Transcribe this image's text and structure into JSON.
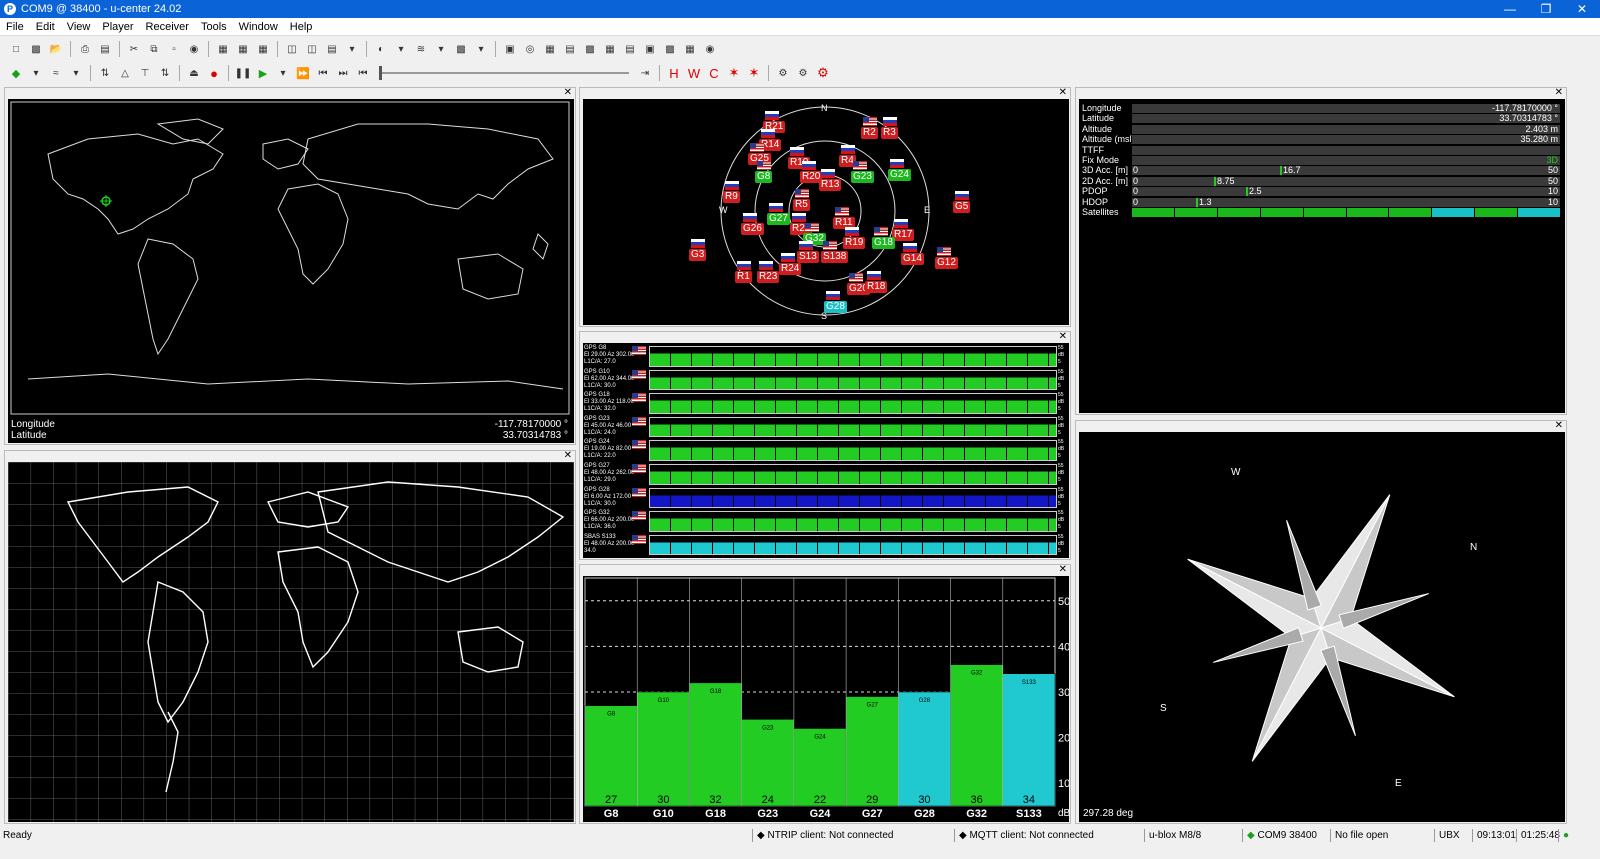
{
  "window": {
    "title": "COM9 @ 38400 - u-center 24.02",
    "icon": "P"
  },
  "menu": [
    "File",
    "Edit",
    "View",
    "Player",
    "Receiver",
    "Tools",
    "Window",
    "Help"
  ],
  "map1": {
    "lon_label": "Longitude",
    "lon_value": "-117.78170000 °",
    "lat_label": "Latitude",
    "lat_value": "33.70314783 °"
  },
  "sky": {
    "compass": [
      "N",
      "E",
      "S",
      "W"
    ],
    "sats": [
      {
        "id": "R21",
        "t": "r"
      },
      {
        "id": "R2",
        "t": "r"
      },
      {
        "id": "R3",
        "t": "r"
      },
      {
        "id": "R14",
        "t": "r"
      },
      {
        "id": "G25",
        "t": "r"
      },
      {
        "id": "R10",
        "t": "r"
      },
      {
        "id": "R4",
        "t": "r"
      },
      {
        "id": "G8",
        "t": "g"
      },
      {
        "id": "R20",
        "t": "r"
      },
      {
        "id": "R13",
        "t": "r"
      },
      {
        "id": "G23",
        "t": "g"
      },
      {
        "id": "G24",
        "t": "g"
      },
      {
        "id": "R9",
        "t": "r"
      },
      {
        "id": "R5",
        "t": "r"
      },
      {
        "id": "G5",
        "t": "r"
      },
      {
        "id": "G27",
        "t": "g"
      },
      {
        "id": "R11",
        "t": "r"
      },
      {
        "id": "G26",
        "t": "r"
      },
      {
        "id": "R22",
        "t": "r"
      },
      {
        "id": "G32",
        "t": "g"
      },
      {
        "id": "R17",
        "t": "r"
      },
      {
        "id": "R19",
        "t": "r"
      },
      {
        "id": "G18",
        "t": "g"
      },
      {
        "id": "G3",
        "t": "r"
      },
      {
        "id": "S13",
        "t": "r"
      },
      {
        "id": "S138",
        "t": "r"
      },
      {
        "id": "R24",
        "t": "r"
      },
      {
        "id": "G14",
        "t": "r"
      },
      {
        "id": "G12",
        "t": "r"
      },
      {
        "id": "R1",
        "t": "r"
      },
      {
        "id": "R23",
        "t": "r"
      },
      {
        "id": "G20",
        "t": "r"
      },
      {
        "id": "R18",
        "t": "r"
      },
      {
        "id": "G28",
        "t": "c"
      }
    ]
  },
  "signal_list": [
    {
      "name": "GPS G8",
      "el": "El 29.00 Az 302.00",
      "l1": "L1C/A: 27.0"
    },
    {
      "name": "GPS G10",
      "el": "El 62.00 Az 344.00",
      "l1": "L1C/A: 30.0"
    },
    {
      "name": "GPS G18",
      "el": "El 33.00 Az 118.00",
      "l1": "L1C/A: 32.0"
    },
    {
      "name": "GPS G23",
      "el": "El 45.00 Az 46.00",
      "l1": "L1C/A: 24.0"
    },
    {
      "name": "GPS G24",
      "el": "El 19.00 Az 82.00",
      "l1": "L1C/A: 22.0"
    },
    {
      "name": "GPS G27",
      "el": "El 48.00 Az 262.00",
      "l1": "L1C/A: 29.0"
    },
    {
      "name": "GPS G28",
      "el": "El 6.00 Az 172.00",
      "l1": "L1C/A: 30.0"
    },
    {
      "name": "GPS G32",
      "el": "El 66.00 Az 200.00",
      "l1": "L1C/A: 36.0"
    },
    {
      "name": "SBAS S133",
      "el": "El 48.00 Az 200.00",
      "l1": "34.0"
    }
  ],
  "signal_scale": [
    "55",
    "dB",
    "5"
  ],
  "chart_data": {
    "type": "bar",
    "categories": [
      "G8",
      "G10",
      "G18",
      "G23",
      "G24",
      "G27",
      "G28",
      "G32",
      "S133"
    ],
    "values": [
      27,
      30,
      32,
      24,
      22,
      29,
      30,
      36,
      34
    ],
    "colors": [
      "#22cc22",
      "#22cc22",
      "#22cc22",
      "#22cc22",
      "#22cc22",
      "#22cc22",
      "#20c8d0",
      "#22cc22",
      "#20c8d0"
    ],
    "yticks": [
      "50",
      "40",
      "30",
      "20",
      "10"
    ],
    "ylim": [
      5,
      55
    ],
    "unit": "dB"
  },
  "dop": {
    "rows": [
      {
        "label": "Longitude",
        "value": "-117.78170000 °"
      },
      {
        "label": "Latitude",
        "value": "33.70314783 °"
      },
      {
        "label": "Altitude",
        "value": "2.403 m"
      },
      {
        "label": "Altitude (msl)",
        "value": "35.280 m"
      },
      {
        "label": "TTFF",
        "value": ""
      },
      {
        "label": "Fix Mode",
        "value": "3D"
      }
    ],
    "bars": [
      {
        "label": "3D Acc. [m]",
        "min": "0",
        "val": "16.7",
        "max": "50",
        "frac": 0.334
      },
      {
        "label": "2D Acc. [m]",
        "min": "0",
        "val": "8.75",
        "max": "50",
        "frac": 0.175
      },
      {
        "label": "PDOP",
        "min": "0",
        "val": "2.5",
        "max": "10",
        "frac": 0.25
      },
      {
        "label": "HDOP",
        "min": "0",
        "val": "1.3",
        "max": "10",
        "frac": 0.13
      }
    ],
    "satellites_label": "Satellites"
  },
  "compass": {
    "heading": "297.28 deg",
    "labels": {
      "n": "N",
      "e": "E",
      "s": "S",
      "w": "W"
    }
  },
  "status": {
    "ready": "Ready",
    "ntrip": "NTRIP client: Not connected",
    "mqtt": "MQTT client: Not connected",
    "receiver": "u-blox M8/8",
    "port": "COM9 38400",
    "file": "No file open",
    "proto": "UBX",
    "time": "09:13:01",
    "elapsed": "01:25:48"
  }
}
